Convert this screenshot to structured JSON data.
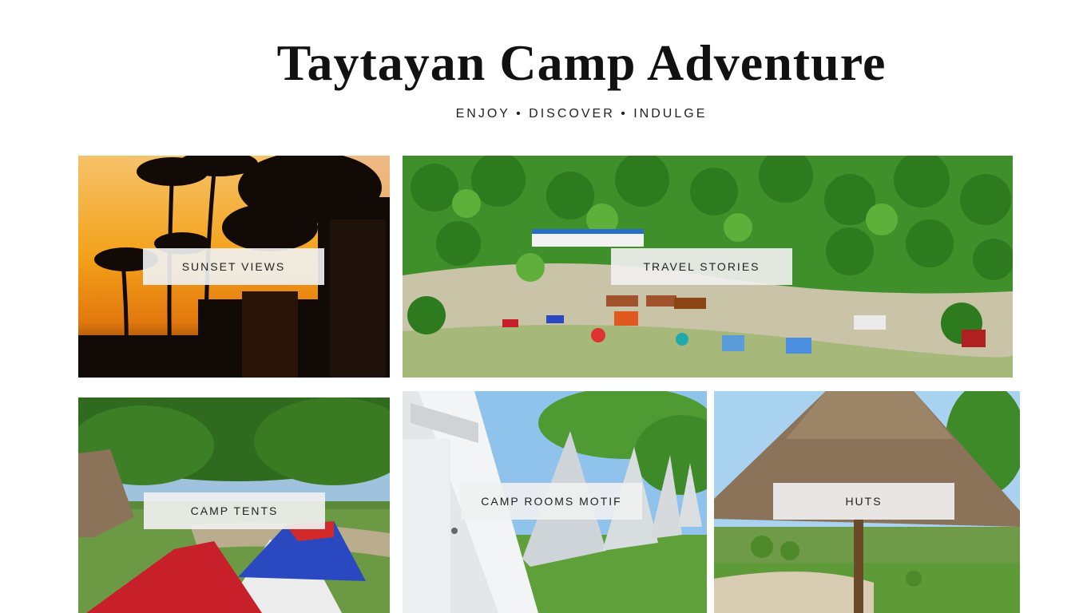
{
  "header": {
    "title": "Taytayan Camp Adventure",
    "tagline": "ENJOY • DISCOVER • INDULGE"
  },
  "gallery": [
    {
      "id": "sunset",
      "label": "SUNSET VIEWS"
    },
    {
      "id": "travel",
      "label": "TRAVEL STORIES"
    },
    {
      "id": "tents",
      "label": "CAMP TENTS"
    },
    {
      "id": "rooms",
      "label": "CAMP ROOMS MOTIF"
    },
    {
      "id": "huts",
      "label": "HUTS"
    }
  ],
  "colors": {
    "sunset_sky": "#f4a21a",
    "foliage": "#3f8f2a",
    "tent_red": "#c8202a",
    "tent_blue": "#2a48c0",
    "sky_blue": "#8fc3ec",
    "thatch": "#8a7358"
  }
}
